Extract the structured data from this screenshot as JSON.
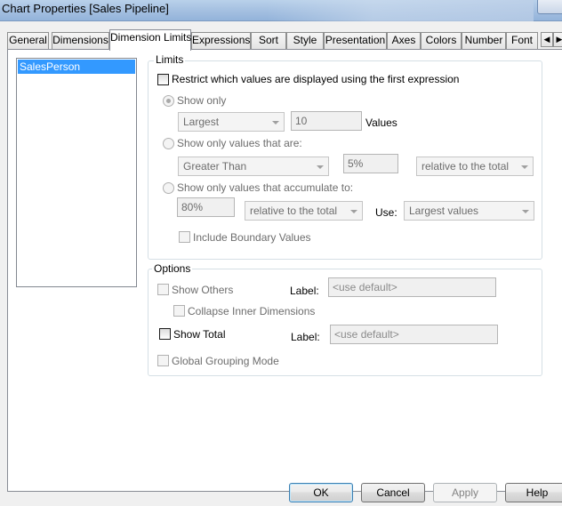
{
  "window": {
    "title": "Chart Properties [Sales Pipeline]"
  },
  "tabs": [
    {
      "label": "General"
    },
    {
      "label": "Dimensions"
    },
    {
      "label": "Dimension Limits",
      "active": true
    },
    {
      "label": "Expressions"
    },
    {
      "label": "Sort"
    },
    {
      "label": "Style"
    },
    {
      "label": "Presentation"
    },
    {
      "label": "Axes"
    },
    {
      "label": "Colors"
    },
    {
      "label": "Number"
    },
    {
      "label": "Font"
    }
  ],
  "tab_scroll": {
    "left": "◀",
    "right": "▶"
  },
  "dimensions_list": {
    "items": [
      "SalesPerson"
    ],
    "selected": "SalesPerson"
  },
  "limits": {
    "group_label": "Limits",
    "restrict_label": "Restrict which values are displayed using the first expression",
    "restrict_checked": false,
    "show_only": {
      "label": "Show only",
      "selected": true,
      "mode_value": "Largest",
      "count_value": "10",
      "values_label": "Values"
    },
    "show_only_values": {
      "label": "Show only values that are:",
      "selected": false,
      "operator_value": "Greater Than",
      "percent_value": "5%",
      "relative_value": "relative to the total"
    },
    "accumulate": {
      "label": "Show only values that accumulate to:",
      "selected": false,
      "percent_value": "80%",
      "relative_value": "relative to the total",
      "use_label": "Use:",
      "use_value": "Largest values"
    },
    "include_boundary_label": "Include Boundary Values"
  },
  "options": {
    "group_label": "Options",
    "show_others_label": "Show Others",
    "show_others_label_field": "Label:",
    "show_others_placeholder": "<use default>",
    "collapse_label": "Collapse Inner Dimensions",
    "show_total_label": "Show Total",
    "show_total_checked": false,
    "show_total_label_field": "Label:",
    "show_total_placeholder": "<use default>",
    "global_grouping_label": "Global Grouping Mode"
  },
  "buttons": {
    "ok": "OK",
    "cancel": "Cancel",
    "apply": "Apply",
    "help": "Help"
  }
}
